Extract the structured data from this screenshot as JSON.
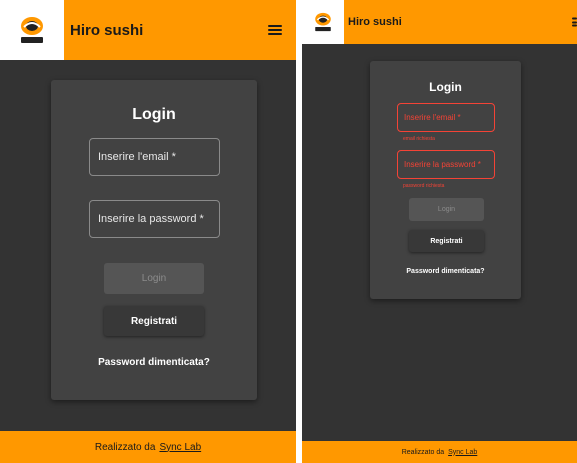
{
  "app": {
    "title": "Hiro sushi"
  },
  "login_form": {
    "title": "Login",
    "email_placeholder": "Inserire l'email *",
    "password_placeholder": "Inserire la password *",
    "email_error": "email richiesta",
    "password_error": "password richiesta",
    "login_label": "Login",
    "register_label": "Registrati",
    "forgot_label": "Password dimenticata?"
  },
  "footer": {
    "prefix": "Realizzato da",
    "link": "Sync Lab"
  },
  "colors": {
    "header": "#ff9800",
    "background": "#333333",
    "card": "#424242",
    "error": "#f44336"
  }
}
